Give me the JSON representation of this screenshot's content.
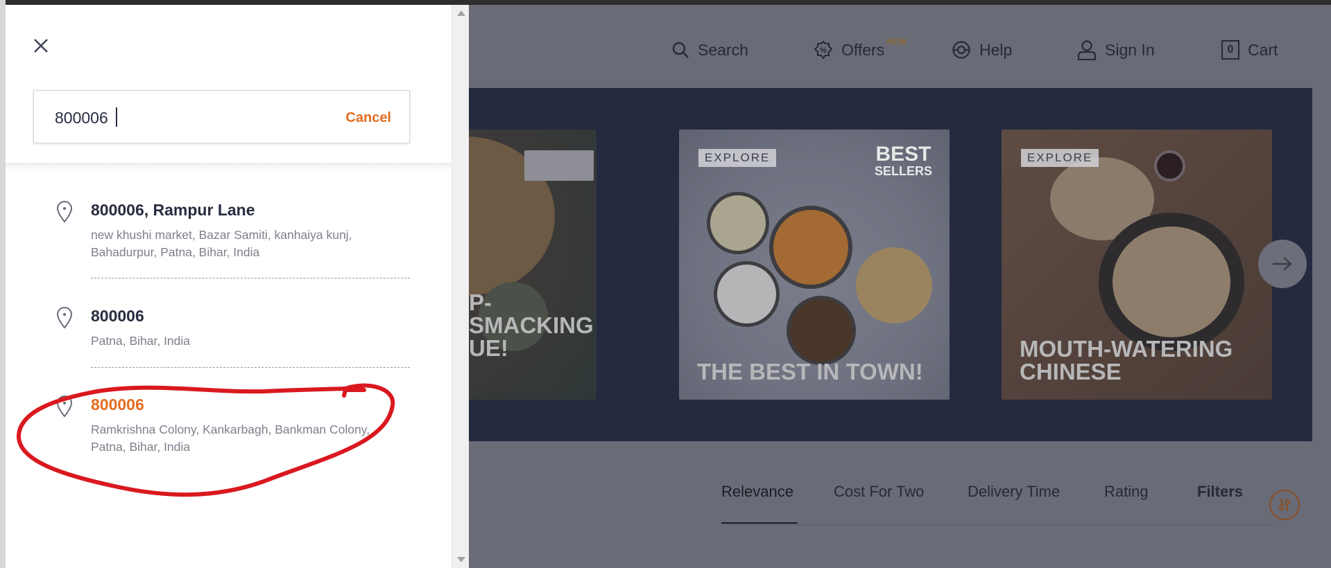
{
  "header": {
    "nav": [
      {
        "label": "Search",
        "icon": "search-icon"
      },
      {
        "label": "Offers",
        "badge": "NEW",
        "icon": "offers-percent-icon"
      },
      {
        "label": "Help",
        "icon": "help-lifebuoy-icon"
      },
      {
        "label": "Sign In",
        "icon": "user-icon"
      },
      {
        "label": "Cart",
        "count": "0",
        "icon": "cart-bag-icon"
      }
    ]
  },
  "banner": {
    "cards": [
      {
        "tag": "",
        "text_line1": "P- SMACKING",
        "text_line2": "UE!",
        "logo": ""
      },
      {
        "tag": "EXPLORE",
        "text_line1": "THE BEST IN TOWN!",
        "text_line2": "",
        "badge_line1": "BEST",
        "badge_line2": "SELLERS"
      },
      {
        "tag": "EXPLORE",
        "text_line1": "MOUTH-WATERING",
        "text_line2": "CHINESE"
      }
    ],
    "next_icon": "arrow-right-icon"
  },
  "sort": {
    "options": [
      "Relevance",
      "Cost For Two",
      "Delivery Time",
      "Rating"
    ],
    "active": "Relevance",
    "filters_label": "Filters"
  },
  "drawer": {
    "search_value": "800006",
    "cancel_label": "Cancel",
    "results": [
      {
        "title": "800006, Rampur Lane",
        "subtitle": "new khushi market, Bazar Samiti, kanhaiya kunj, Bahadurpur, Patna, Bihar, India",
        "highlighted": false
      },
      {
        "title": "800006",
        "subtitle": "Patna, Bihar, India",
        "highlighted": false
      },
      {
        "title": "800006",
        "subtitle": "Ramkrishna Colony, Kankarbagh, Bankman Colony, Patna, Bihar, India",
        "highlighted": true
      }
    ]
  },
  "colors": {
    "accent_orange": "#e46d1f",
    "overlay": "#696b77",
    "banner_bg": "#242a3f",
    "annotation_red": "#d9191f"
  }
}
